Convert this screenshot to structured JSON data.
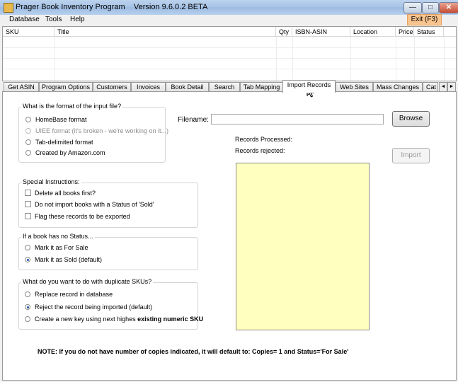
{
  "window": {
    "title": "Prager Book Inventory Program",
    "version": "Version 9.6.0.2 BETA",
    "min_glyph": "—",
    "max_glyph": "□",
    "close_glyph": "✕"
  },
  "menu": {
    "items": [
      "Database",
      "Tools",
      "Help"
    ],
    "exit_label": "Exit (F3)"
  },
  "grid": {
    "columns": [
      "SKU",
      "Title",
      "Qty",
      "ISBN-ASIN",
      "Location",
      "Price",
      "Status"
    ]
  },
  "tabs": {
    "items": [
      "Get ASIN",
      "Program Options",
      "Customers",
      "Invoices",
      "Book Detail",
      "Search",
      "Tab Mapping",
      "Import Records",
      "Web Sites",
      "Mass Changes",
      "Cat"
    ],
    "active": "Import Records",
    "scroll_left": "◄",
    "scroll_right": "►"
  },
  "import": {
    "format_group": {
      "title": "What is the format of the input file?",
      "options": [
        {
          "label": "HomeBase format",
          "selected": false,
          "enabled": true
        },
        {
          "label": "UIEE format (it's broken - we're working on it...)",
          "selected": false,
          "enabled": false
        },
        {
          "label": "Tab-delimited format",
          "selected": false,
          "enabled": true
        },
        {
          "label": "Created by Amazon.com",
          "selected": false,
          "enabled": true
        }
      ]
    },
    "special_group": {
      "title": "Special Instructions:",
      "options": [
        {
          "label": "Delete all books first?",
          "checked": false
        },
        {
          "label": "Do not import books with a Status of 'Sold'",
          "checked": false
        },
        {
          "label": "Flag these records to be exported",
          "checked": false
        }
      ]
    },
    "status_group": {
      "title": "If a book has no Status...",
      "options": [
        {
          "label": "Mark it as For Sale",
          "selected": false
        },
        {
          "label": "Mark it as Sold (default)",
          "selected": true
        }
      ]
    },
    "dup_group": {
      "title": "What do you want to do with duplicate SKUs?",
      "options": [
        {
          "label": "Replace record in database",
          "selected": false
        },
        {
          "label": "Reject the record being imported (default)",
          "selected": true
        },
        {
          "label": "Create a new key using next highes",
          "bold_suffix": "existing numeric SKU",
          "selected": false
        }
      ]
    },
    "filename_label": "Filename:",
    "filename_value": "",
    "browse_label": "Browse",
    "records_processed_label": "Records Processed:",
    "records_rejected_label": "Records rejected:",
    "import_label": "Import",
    "note": "NOTE: If you do not have number of copies indicated, it will default to: Copies= 1 and Status='For Sale'"
  }
}
